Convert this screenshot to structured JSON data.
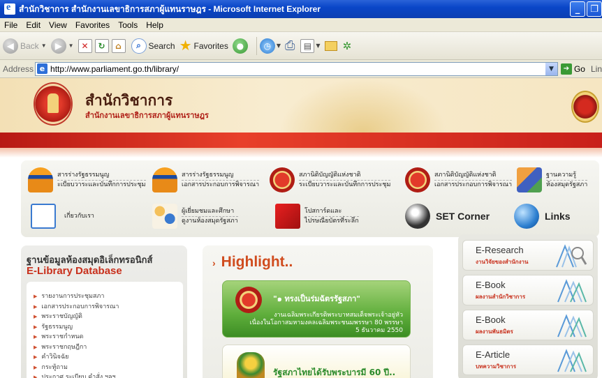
{
  "window": {
    "title": "สำนักวิชาการ สำนักงานเลขาธิการสภาผู้แทนราษฎร - Microsoft Internet Explorer",
    "minimize": "_",
    "restore": "❐"
  },
  "menu": [
    "File",
    "Edit",
    "View",
    "Favorites",
    "Tools",
    "Help"
  ],
  "toolbar": {
    "back_label": "Back",
    "search_label": "Search",
    "favorites_label": "Favorites"
  },
  "address": {
    "label": "Address",
    "url": "http://www.parliament.go.th/library/",
    "go_label": "Go",
    "links_label": "Lin"
  },
  "site": {
    "title": "สำนักวิชาการ",
    "subtitle": "สำนักงานเลขาธิการสภาผู้แทนราษฎร"
  },
  "nav": [
    {
      "line1": "สารร่างรัฐธรรมนูญ",
      "line2": "ะเบียบวาระและบันทึกการประชุม"
    },
    {
      "line1": "สารร่างรัฐธรรมนูญ",
      "line2": "เอกสารประกอบการพิจารณา"
    },
    {
      "line1": "สภานิติบัญญัติแห่งชาติ",
      "line2": "ระเบียบวาระและบันทึกการประชุม"
    },
    {
      "line1": "สภานิติบัญญัติแห่งชาติ",
      "line2": "เอกสารประกอบการพิจารณา"
    },
    {
      "line1": "ฐานความรู้",
      "line2": "ห้องสมุดรัฐสภา"
    },
    {
      "line1": "เกี่ยวกับเรา",
      "line2": ""
    },
    {
      "line1": "ผู้เยี่ยมชมและศึกษา",
      "line2": "ดูงานห้องสมุดรัฐสภา"
    },
    {
      "line1": "โปสการ์ดและ",
      "line2": "ไปรษณียบัตรที่ระลึก"
    },
    {
      "big": "SET Corner"
    },
    {
      "big": "Links"
    }
  ],
  "database": {
    "title_th": "ฐานข้อมูลห้องสมุดอิเล็กทรอนิกส์",
    "title_en": "E-Library Database",
    "items": [
      "รายงานการประชุมสภา",
      "เอกสารประกอบการพิจารณา",
      "พระราชบัญญัติ",
      "รัฐธรรมนูญ",
      "พระราชกำหนด",
      "พระราชกฤษฎีกา",
      "คำวินิจฉัย",
      "กระทู้ถาม",
      "ประกาศ ระเบียบ คำสั่ง ฯลฯ"
    ]
  },
  "highlight": {
    "title": "Highlight..",
    "card1": {
      "head": "\"๑ ทรงเป็นร่มฉัตรรัฐสภา\"",
      "line1": "งานเฉลิมพระเกียรติพระบาทสมเด็จพระเจ้าอยู่หัว",
      "line2": "เนื่องในโอกาสมหามงคลเฉลิมพระชนมพรรษา 80 พรรษา",
      "line3": "5 ธันวาคม 2550"
    },
    "card2": {
      "head": "รัฐสภาไทยได้รับพระบารมี 60 ปี.."
    }
  },
  "right_links": [
    {
      "name": "E-Research",
      "sub": "งานวิจัยของสำนักงาน"
    },
    {
      "name": "E-Book",
      "sub": "ผลงานสำนักวิชาการ"
    },
    {
      "name": "E-Book",
      "sub": "ผลงานพันธมิตร"
    },
    {
      "name": "E-Article",
      "sub": "บทความวิชาการ"
    }
  ]
}
